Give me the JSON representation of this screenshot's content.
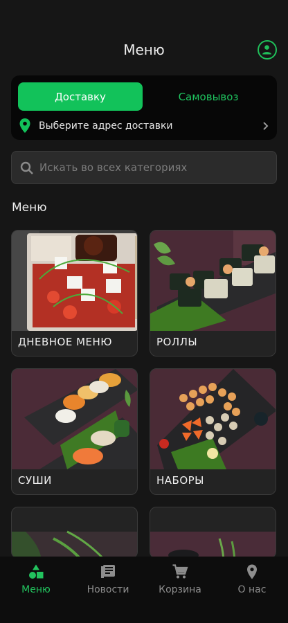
{
  "header": {
    "title": "Меню"
  },
  "delivery": {
    "tabs": [
      {
        "label": "Доставку",
        "active": true
      },
      {
        "label": "Самовывоз",
        "active": false
      }
    ],
    "address_prompt": "Выберите адрес доставки"
  },
  "search": {
    "placeholder": "Искать во всех категориях",
    "value": ""
  },
  "menu": {
    "section_title": "Меню",
    "categories": [
      {
        "label": "ДНЕВНОЕ МЕНЮ"
      },
      {
        "label": "РОЛЛЫ"
      },
      {
        "label": "СУШИ"
      },
      {
        "label": "НАБОРЫ"
      },
      {
        "label": ""
      },
      {
        "label": ""
      }
    ]
  },
  "bottom_nav": {
    "items": [
      {
        "label": "Меню",
        "icon": "shapes-icon",
        "active": true
      },
      {
        "label": "Новости",
        "icon": "news-icon",
        "active": false
      },
      {
        "label": "Корзина",
        "icon": "cart-icon",
        "active": false
      },
      {
        "label": "О нас",
        "icon": "location-pin-icon",
        "active": false
      }
    ]
  },
  "colors": {
    "accent": "#12c25a",
    "background": "#161616",
    "card": "#232323"
  }
}
